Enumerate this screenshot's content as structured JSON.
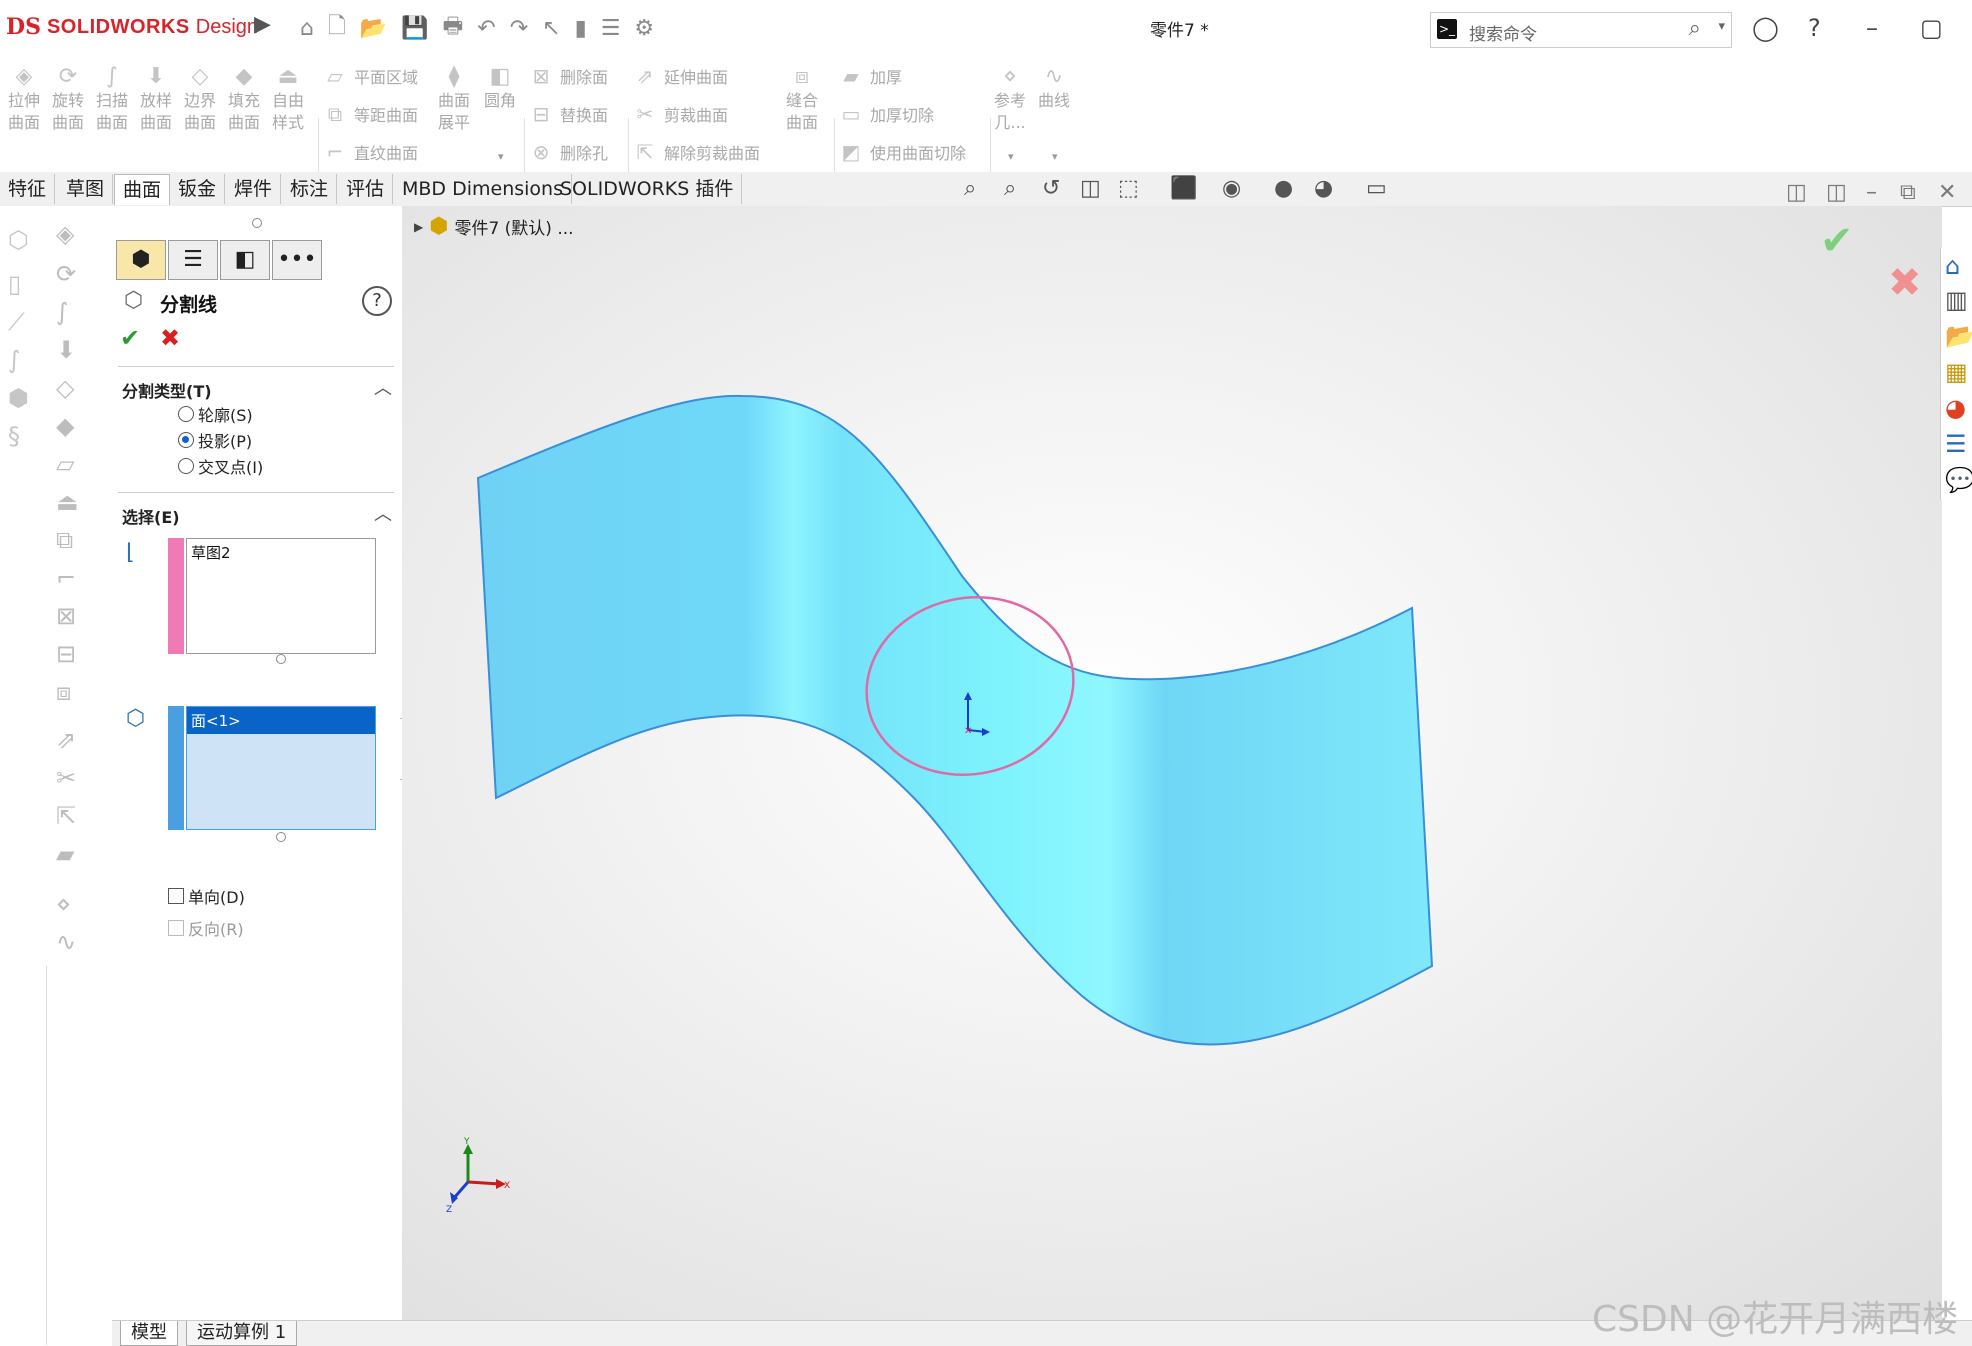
{
  "app": {
    "brand_prefix": "DS",
    "brand_name": "SOLIDWORKS",
    "brand_suffix": "Design",
    "doc_title": "零件7 *"
  },
  "search": {
    "placeholder": "搜索命令"
  },
  "commands": {
    "extrude": [
      "拉伸",
      "曲面"
    ],
    "revolve": [
      "旋转",
      "曲面"
    ],
    "sweep": [
      "扫描",
      "曲面"
    ],
    "loft": [
      "放样",
      "曲面"
    ],
    "boundary": [
      "边界",
      "曲面"
    ],
    "fill": [
      "填充",
      "曲面"
    ],
    "freeform": [
      "自由",
      "样式"
    ],
    "planar": "平面区域",
    "offset": "等距曲面",
    "ruled": "直纹曲面",
    "flatten": [
      "曲面",
      "展平"
    ],
    "fillet": "圆角",
    "delete_face": "删除面",
    "replace_face": "替换面",
    "delete_hole": "删除孔",
    "extend": "延伸曲面",
    "trim": "剪裁曲面",
    "untrim": "解除剪裁曲面",
    "knit": [
      "缝合",
      "曲面"
    ],
    "thicken": "加厚",
    "thicken_cut": "加厚切除",
    "cut_with_surface": "使用曲面切除",
    "reference": [
      "参考",
      "几..."
    ],
    "curves": "曲线"
  },
  "tabs": [
    "特征",
    "草图",
    "曲面",
    "钣金",
    "焊件",
    "标注",
    "评估",
    "MBD Dimensions",
    "SOLIDWORKS 插件"
  ],
  "active_tab": "曲面",
  "property_manager": {
    "title": "分割线",
    "split_type": {
      "header": "分割类型(T)",
      "options": [
        "轮廓(S)",
        "投影(P)",
        "交叉点(I)"
      ],
      "selected": "投影(P)"
    },
    "selection": {
      "header": "选择(E)",
      "sketch_list": [
        "草图2"
      ],
      "face_list": [
        "面<1>"
      ]
    },
    "single_direction": {
      "label": "单向(D)",
      "checked": false
    },
    "reverse": {
      "label": "反向(R)",
      "checked": false,
      "enabled": false
    }
  },
  "feature_tree": {
    "item": "零件7 (默认) ..."
  },
  "triad": {
    "x": "X",
    "y": "Y",
    "z": "Z"
  },
  "bottom_tabs": [
    "模型",
    "运动算例 1"
  ],
  "watermark": "CSDN @花开月满西楼",
  "colors": {
    "brand_red": "#d8232a",
    "surface": "#6fd8f7",
    "sketch_circle": "#e06aa6",
    "select_blue": "#0a64c8",
    "ok_green": "#2f9a2f",
    "cancel_red": "#d82020"
  }
}
